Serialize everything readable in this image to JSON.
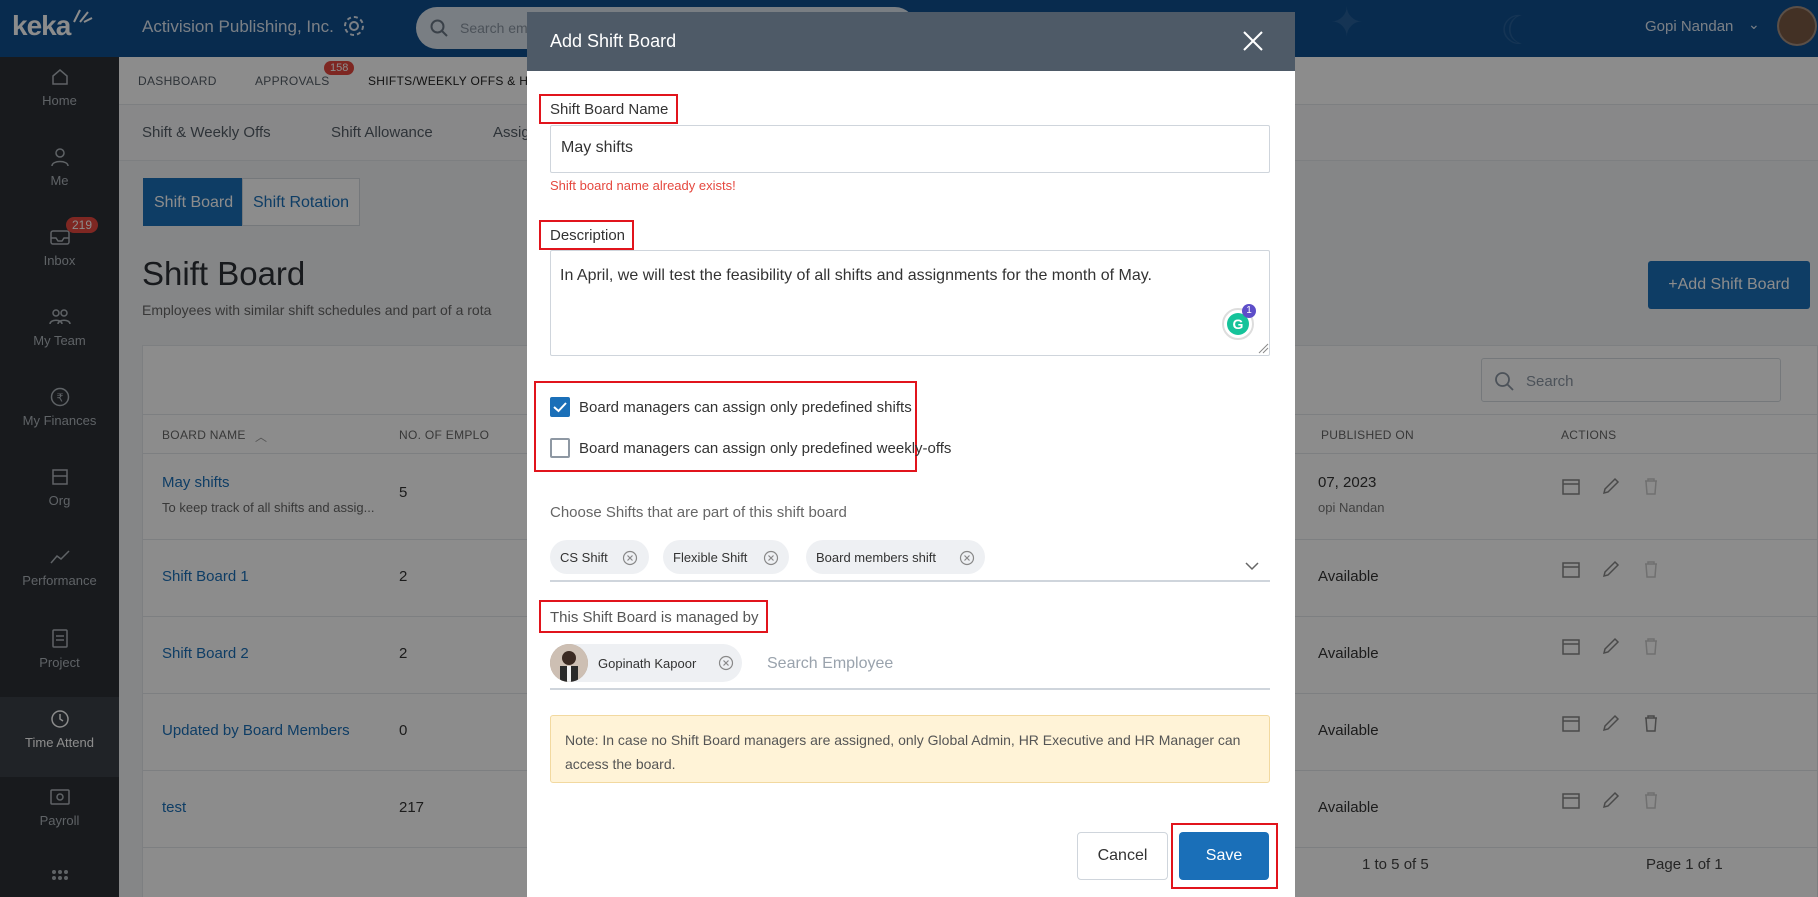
{
  "app": {
    "logo": "keka",
    "company": "Activision Publishing, Inc.",
    "search_placeholder": "Search em",
    "user_name": "Gopi Nandan"
  },
  "sidebar": {
    "items": [
      {
        "label": "Home",
        "icon": "home-icon"
      },
      {
        "label": "Me",
        "icon": "user-icon"
      },
      {
        "label": "Inbox",
        "icon": "inbox-icon",
        "badge": "219"
      },
      {
        "label": "My Team",
        "icon": "team-icon"
      },
      {
        "label": "My Finances",
        "icon": "rupee-icon"
      },
      {
        "label": "Org",
        "icon": "org-icon"
      },
      {
        "label": "Performance",
        "icon": "chart-icon"
      },
      {
        "label": "Project",
        "icon": "clipboard-icon"
      },
      {
        "label": "Time Attend",
        "icon": "clock-icon",
        "active": true
      },
      {
        "label": "Payroll",
        "icon": "payroll-icon"
      }
    ]
  },
  "subnav": {
    "items": [
      "DASHBOARD",
      "APPROVALS",
      "SHIFTS/WEEKLY OFFS & H"
    ],
    "approvals_badge": "158"
  },
  "tabs": [
    "Shift & Weekly Offs",
    "Shift Allowance",
    "Assig"
  ],
  "segments": {
    "active": "Shift Board",
    "inactive": "Shift Rotation"
  },
  "page": {
    "title": "Shift Board",
    "subtitle": "Employees with similar shift schedules and part of a rota",
    "add_button": "+Add Shift Board",
    "table_search_placeholder": "Search"
  },
  "table": {
    "headers": {
      "name": "BOARD NAME",
      "employees": "NO. OF EMPLO",
      "published": "PUBLISHED ON",
      "actions": "ACTIONS"
    },
    "rows": [
      {
        "name": "May shifts",
        "desc": "To keep track of all shifts and assig...",
        "count": "5",
        "published": "07, 2023",
        "published_by": "opi Nandan"
      },
      {
        "name": "Shift Board 1",
        "desc": "",
        "count": "2",
        "published": "Available",
        "published_by": ""
      },
      {
        "name": "Shift Board 2",
        "desc": "",
        "count": "2",
        "published": "Available",
        "published_by": ""
      },
      {
        "name": "Updated by Board Members",
        "desc": "",
        "count": "0",
        "published": "Available",
        "published_by": ""
      },
      {
        "name": "test",
        "desc": "",
        "count": "217",
        "published": "Available",
        "published_by": ""
      }
    ],
    "pager_info": "1 to 5 of 5",
    "pager_page": "Page 1 of 1"
  },
  "modal": {
    "title": "Add Shift Board",
    "name_label": "Shift Board Name",
    "name_value": "May shifts",
    "name_error": "Shift board name already exists!",
    "desc_label": "Description",
    "desc_value": "In April, we will test the feasibility of all shifts and assignments for the month of May.",
    "grammarly_badge": "1",
    "checkbox_shifts": {
      "label": "Board managers can assign only predefined shifts",
      "checked": true
    },
    "checkbox_weekly": {
      "label": "Board managers can assign only predefined weekly-offs",
      "checked": false
    },
    "shifts_label": "Choose Shifts that are part of this shift board",
    "shift_chips": [
      "CS Shift",
      "Flexible Shift",
      "Board members shift"
    ],
    "managed_label": "This Shift Board is managed by",
    "manager_chip": "Gopinath Kapoor",
    "employee_search_placeholder": "Search Employee",
    "note": "Note: In case no Shift Board managers are assigned, only Global Admin, HR Executive and HR Manager can access the board.",
    "cancel": "Cancel",
    "save": "Save"
  },
  "colors": {
    "primary": "#1a6fb8",
    "highlight": "#e1141c",
    "header": "#4e5a67",
    "note_bg": "#fff3d7"
  }
}
